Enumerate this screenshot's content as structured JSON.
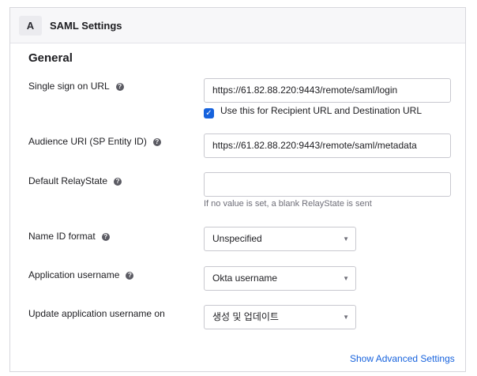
{
  "header": {
    "letter": "A",
    "title": "SAML Settings"
  },
  "section": {
    "title": "General"
  },
  "fields": {
    "sso_url": {
      "label": "Single sign on URL",
      "value": "https://61.82.88.220:9443/remote/saml/login"
    },
    "recipient_check": {
      "label": "Use this for Recipient URL and Destination URL",
      "checked": true
    },
    "audience_uri": {
      "label": "Audience URI (SP Entity ID)",
      "value": "https://61.82.88.220:9443/remote/saml/metadata"
    },
    "relay_state": {
      "label": "Default RelayState",
      "value": "",
      "hint": "If no value is set, a blank RelayState is sent"
    },
    "name_id_format": {
      "label": "Name ID format",
      "value": "Unspecified"
    },
    "app_username": {
      "label": "Application username",
      "value": "Okta username"
    },
    "update_username_on": {
      "label": "Update application username on",
      "value": "생성 및 업데이트"
    }
  },
  "links": {
    "show_advanced": "Show Advanced Settings"
  },
  "colors": {
    "accent": "#1662dd",
    "header_bg": "#f7f7f9",
    "border": "#d7d7dc"
  },
  "icons": {
    "help": "help-icon",
    "check": "checkmark-icon",
    "dropdown": "caret-down-icon"
  }
}
